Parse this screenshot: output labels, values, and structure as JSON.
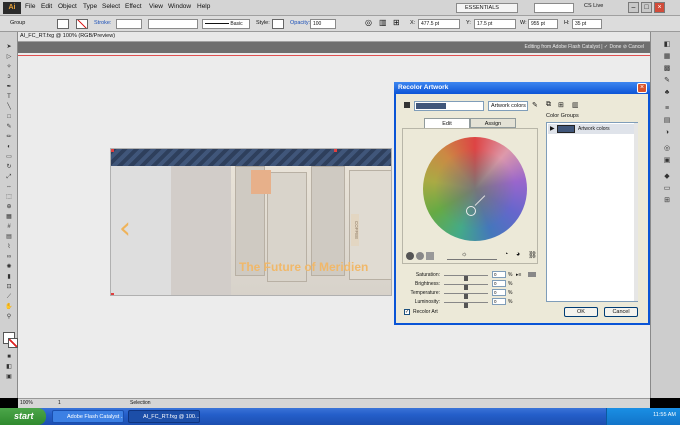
{
  "menubar": {
    "logo": "Ai",
    "items": [
      "File",
      "Edit",
      "Object",
      "Type",
      "Select",
      "Effect",
      "View",
      "Window",
      "Help"
    ],
    "workspace": "ESSENTIALS",
    "cs_live": "CS Live"
  },
  "control": {
    "group_label": "Group",
    "stroke_label": "Stroke:",
    "brush_label": "Basic",
    "style_label": "Style:",
    "opacity_label": "Opacity:",
    "opacity_value": "100",
    "x_label": "X:",
    "x_value": "477.5 pt",
    "y_label": "Y:",
    "y_value": "17.5 pt",
    "w_label": "W:",
    "w_value": "955 pt",
    "h_label": "H:",
    "h_value": "35 pt"
  },
  "document": {
    "tab_title": "AI_FC_RT.fxg @ 100% (RGB/Preview)",
    "flash_bar": "Editing from Adobe Flash Catalyst  |  ✓ Done  ⊘ Cancel"
  },
  "artwork": {
    "title": "The Future of Meridien",
    "chevron": "‹",
    "sign_text": "COFFEE"
  },
  "dialog": {
    "title": "Recolor Artwork",
    "close": "×",
    "name_value": "Artwork colors",
    "tabs": [
      "Edit",
      "Assign"
    ],
    "sliders": [
      {
        "label": "Saturation:",
        "value": "0",
        "pct": "%"
      },
      {
        "label": "Brightness:",
        "value": "0",
        "pct": "%"
      },
      {
        "label": "Temperature:",
        "value": "0",
        "pct": "%"
      },
      {
        "label": "Luminosity:",
        "value": "0",
        "pct": "%"
      }
    ],
    "color_groups_label": "Color Groups",
    "color_group_item": "Artwork colors",
    "recolor_art_label": "Recolor Art",
    "ok": "OK",
    "cancel": "Cancel"
  },
  "status": {
    "zoom": "100%",
    "page": "1",
    "tool": "Selection"
  },
  "taskbar": {
    "start": "start",
    "tasks": [
      "Adobe Flash Catalyst ...",
      "AI_FC_RT.fxg @ 100..."
    ],
    "clock": "11:55 AM"
  }
}
